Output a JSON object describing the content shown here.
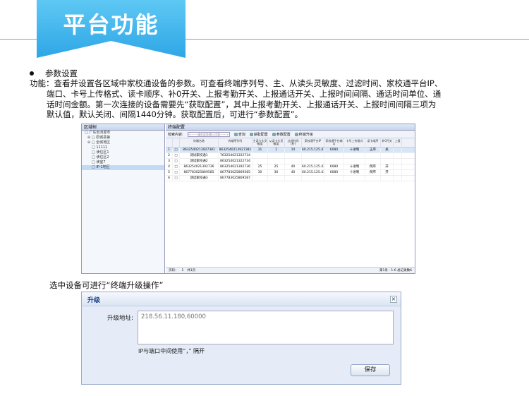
{
  "banner": {
    "title": "平台功能"
  },
  "section": {
    "title": "参数设置",
    "body_lines": [
      "功能：查看并设置各区域中家校通设备的参数。可查看终端序列号、主、从读头灵敏度、过滤时间、家校通平台IP、",
      "端口、卡号上传格式、读卡顺序、补0开关、上报考勤开关、上报通话开关、上报时间间隔、通话时间单位、通",
      "话时间金额。第一次连接的设备需要先“获取配置”，其中上报考勤开关、上报通话开关、上报时间间隔三项为",
      "默认值，默认关闭、间隔1440分钟。获取配置后，可进行“参数配置”。"
    ]
  },
  "app": {
    "tree_header": "区域树",
    "tree": [
      "□ 广东省河源市",
      "⊖ □ 原城县第",
      "⊖ □ 全城地区",
      "□ 11111",
      "□ 读位区1",
      "□ 读位区2",
      "□ 读室7",
      "□ IP-1地区"
    ],
    "main_header": "终端配置",
    "toolbar": {
      "search_label": "检索内容:",
      "search_placeholder": "<-------请在此处输入内容------>",
      "btn_search": "查询",
      "btn_get": "获取配置",
      "btn_config": "参数配置",
      "btn_upgrade": "终端升级"
    },
    "columns": [
      "",
      "",
      "终端名称",
      "终端序列号",
      "主读卡头灵敏度",
      "从读卡头灵敏度",
      "过滤时间(秒)",
      "家校通平台IP",
      "家校通平台端口",
      "卡号上传格式",
      "读卡顺序",
      "补0开关",
      "上报"
    ],
    "rows": [
      [
        "1",
        "□",
        "8632540213927381",
        "8632540213927381",
        "31",
        "1",
        "10",
        "60.215.125.43",
        "6080",
        "十进制",
        "正序",
        "关",
        ""
      ],
      [
        "2",
        "□",
        "测试家校通1",
        "763254021322734",
        "",
        "",
        "",
        "",
        "",
        "",
        "",
        "",
        ""
      ],
      [
        "3",
        "□",
        "测试家校通2",
        "863254021322734",
        "",
        "",
        "",
        "",
        "",
        "",
        "",
        "",
        ""
      ],
      [
        "4",
        "□",
        "863254021392736",
        "863254021392736",
        "25",
        "25",
        "40",
        "60.215.125.43",
        "6080",
        "十进制",
        "倒序",
        "开",
        ""
      ],
      [
        "5",
        "□",
        "867783025869585",
        "867783025869585",
        "30",
        "30",
        "40",
        "60.215.125.43",
        "6080",
        "十进制",
        "倒序",
        "开",
        ""
      ],
      [
        "6",
        "□",
        "测试家校通3",
        "867783025869587",
        "",
        "",
        "",
        "",
        "",
        "",
        "",
        "",
        ""
      ]
    ],
    "pager": {
      "page_label": "页码：",
      "page_value": "1",
      "page_total": "共1页",
      "summary": "第1条 - 1-6 总记录数6"
    }
  },
  "caption": "选中设备可进行“终端升级操作”",
  "dialog": {
    "title": "升级",
    "close": "×",
    "address_label": "升级地址:",
    "address_value": "218.56.11.180,60000",
    "note": "IP与端口中间使用“，” 隔开",
    "save_label": "保存"
  }
}
